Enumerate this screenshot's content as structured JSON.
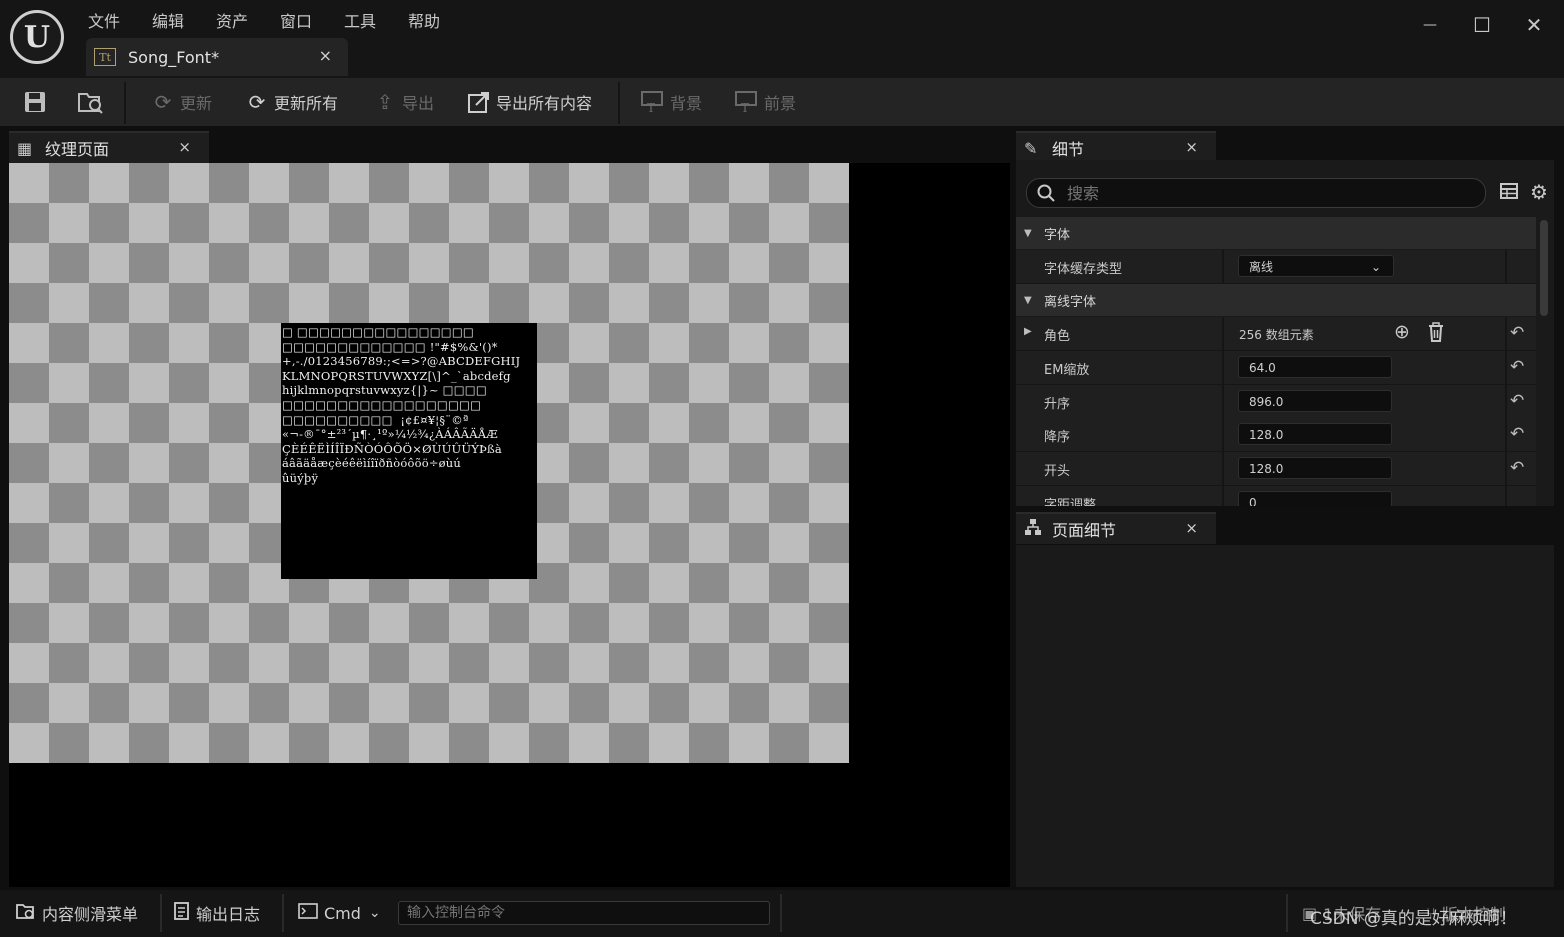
{
  "menu": [
    "文件",
    "编辑",
    "资产",
    "窗口",
    "工具",
    "帮助"
  ],
  "logo_text": "U",
  "window_controls": {
    "minimize": "—",
    "maximize": "☐",
    "close": "✕"
  },
  "document_tab": {
    "icon_text": "Tt",
    "title": "Song_Font*",
    "close": "×"
  },
  "toolbar": {
    "refresh": "更新",
    "refresh_all": "更新所有",
    "export": "导出",
    "export_all": "导出所有内容",
    "background": "背景",
    "foreground": "前景"
  },
  "texture_panel": {
    "title": "纹理页面",
    "close": "×"
  },
  "font_atlas_lines": [
    "□ □□□□□□□□□□□□□□□□",
    "□□□□□□□□□□□□□ !\"#$%&'()*",
    "+,-./0123456789:;<=>?@ABCDEFGHIJ",
    "KLMNOPQRSTUVWXYZ[\\]^_`abcdefg",
    "hijklmnopqrstuvwxyz{|}~ □□□□",
    "□□□□□□□□□□□□□□□□□□",
    "□□□□□□□□□□  ¡¢£¤¥¦§¨©ª",
    "«¬-®¯°±²³´µ¶·¸¹º»¼½¾¿ÀÁÂÃÄÅÆ",
    "ÇÈÉÊËÌÍÎÏÐÑÒÓÔÕÖ×ØÙÚÛÜÝÞßà",
    "áâãäåæçèéêëìíîïðñòóôõö÷øùú",
    "ûüýþÿ"
  ],
  "details_panel": {
    "title": "细节",
    "close": "×",
    "search_placeholder": "搜索",
    "categories": {
      "font": "字体",
      "offline_font": "离线字体"
    },
    "font_cache_type": {
      "label": "字体缓存类型",
      "value": "离线"
    },
    "characters": {
      "label": "角色",
      "value": "256 数组元素"
    },
    "em_scale": {
      "label": "EM缩放",
      "value": "64.0"
    },
    "ascent": {
      "label": "升序",
      "value": "896.0"
    },
    "descent": {
      "label": "降序",
      "value": "128.0"
    },
    "leading": {
      "label": "开头",
      "value": "128.0"
    },
    "kerning": {
      "label": "字距调整",
      "value": "0"
    }
  },
  "page_details_panel": {
    "title": "页面细节",
    "close": "×"
  },
  "statusbar": {
    "content_drawer": "内容侧滑菜单",
    "output_log": "输出日志",
    "cmd": "Cmd",
    "console_placeholder": "输入控制台命令",
    "unsaved": "1未保存",
    "source_control": "版本控制"
  },
  "watermark": "CSDN @真的是好麻烦啊！"
}
